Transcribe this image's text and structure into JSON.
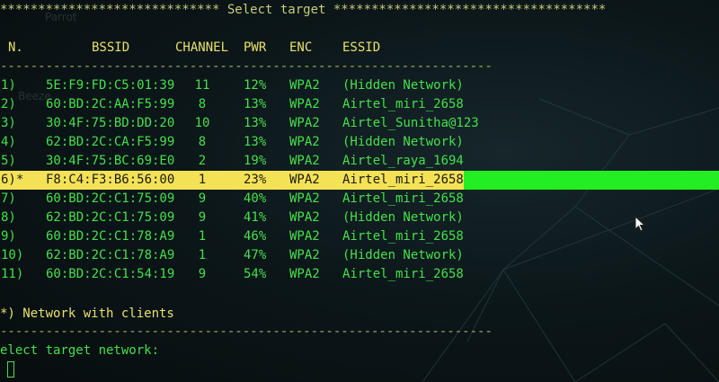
{
  "title_line": "***************************** Select target ************************************",
  "columns": [
    "N.",
    "BSSID",
    "CHANNEL",
    "PWR",
    "ENC",
    "ESSID"
  ],
  "separator": "-----------------------------------------------------------------",
  "rows": [
    {
      "n": "1)",
      "bssid": "5E:F9:FD:C5:01:39",
      "channel": "11",
      "pwr": "12%",
      "enc": "WPA2",
      "essid": "(Hidden Network)"
    },
    {
      "n": "2)",
      "bssid": "60:BD:2C:AA:F5:99",
      "channel": "8",
      "pwr": "13%",
      "enc": "WPA2",
      "essid": "Airtel_miri_2658"
    },
    {
      "n": "3)",
      "bssid": "30:4F:75:BD:DD:20",
      "channel": "10",
      "pwr": "13%",
      "enc": "WPA2",
      "essid": "Airtel_Sunitha@123"
    },
    {
      "n": "4)",
      "bssid": "62:BD:2C:CA:F5:99",
      "channel": "8",
      "pwr": "13%",
      "enc": "WPA2",
      "essid": "(Hidden Network)"
    },
    {
      "n": "5)",
      "bssid": "30:4F:75:BC:69:E0",
      "channel": "2",
      "pwr": "19%",
      "enc": "WPA2",
      "essid": "Airtel_raya_1694"
    },
    {
      "n": "6)*",
      "bssid": "F8:C4:F3:B6:56:00",
      "channel": "1",
      "pwr": "23%",
      "enc": "WPA2",
      "essid": "Airtel_miri_2658"
    },
    {
      "n": "7)",
      "bssid": "60:BD:2C:C1:75:09",
      "channel": "9",
      "pwr": "40%",
      "enc": "WPA2",
      "essid": "Airtel_miri_2658"
    },
    {
      "n": "8)",
      "bssid": "62:BD:2C:C1:75:09",
      "channel": "9",
      "pwr": "41%",
      "enc": "WPA2",
      "essid": "(Hidden Network)"
    },
    {
      "n": "9)",
      "bssid": "60:BD:2C:C1:78:A9",
      "channel": "1",
      "pwr": "46%",
      "enc": "WPA2",
      "essid": "Airtel_miri_2658"
    },
    {
      "n": "10)",
      "bssid": "62:BD:2C:C1:78:A9",
      "channel": "1",
      "pwr": "47%",
      "enc": "WPA2",
      "essid": "(Hidden Network)"
    },
    {
      "n": "11)",
      "bssid": "60:BD:2C:C1:54:19",
      "channel": "9",
      "pwr": "54%",
      "enc": "WPA2",
      "essid": "Airtel_miri_2658"
    }
  ],
  "selected_row": 5,
  "footnote": "*) Network with clients",
  "prompt": "elect target network:",
  "ghost_labels": [
    "Parrot",
    "Beeze"
  ],
  "colors": {
    "green": "#45e04a",
    "highlight": "#f4e256",
    "highlight_extend": "#22ee22"
  }
}
